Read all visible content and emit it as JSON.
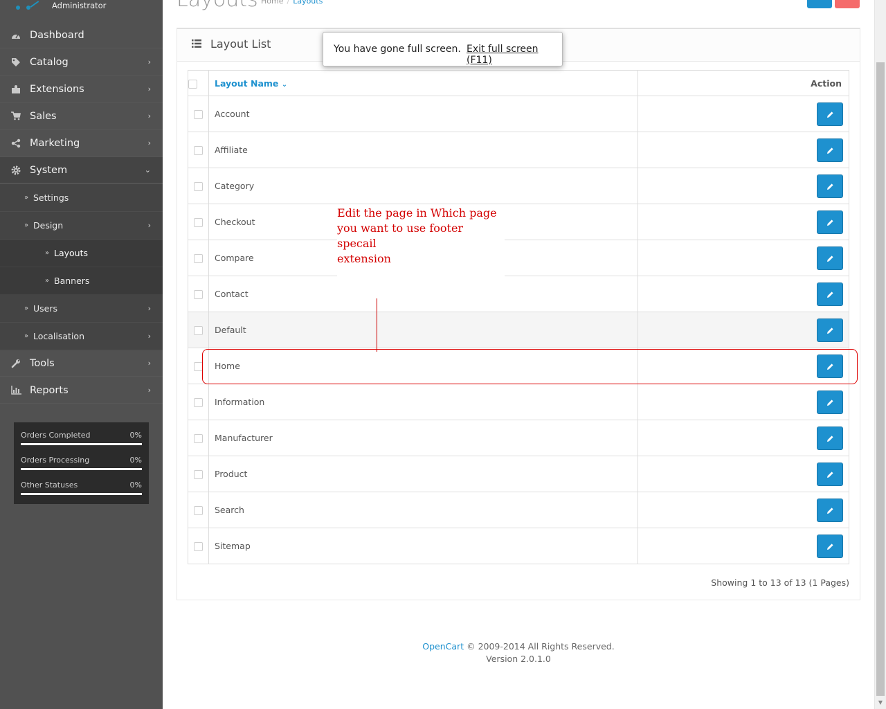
{
  "header": {
    "title": "Layouts",
    "breadcrumb": [
      "Home",
      "Layouts"
    ]
  },
  "profile": {
    "role": "Administrator"
  },
  "sidebar": {
    "items": [
      {
        "label": "Dashboard",
        "icon": "dashboard-icon"
      },
      {
        "label": "Catalog",
        "icon": "tag-icon"
      },
      {
        "label": "Extensions",
        "icon": "puzzle-icon"
      },
      {
        "label": "Sales",
        "icon": "cart-icon"
      },
      {
        "label": "Marketing",
        "icon": "share-icon"
      },
      {
        "label": "System",
        "icon": "gear-icon"
      },
      {
        "label": "Settings"
      },
      {
        "label": "Design"
      },
      {
        "label": "Layouts"
      },
      {
        "label": "Banners"
      },
      {
        "label": "Users"
      },
      {
        "label": "Localisation"
      },
      {
        "label": "Tools",
        "icon": "wrench-icon"
      },
      {
        "label": "Reports",
        "icon": "bar-chart-icon"
      }
    ]
  },
  "stats": [
    {
      "label": "Orders Completed",
      "value": "0%",
      "fraction": 0
    },
    {
      "label": "Orders Processing",
      "value": "0%",
      "fraction": 0
    },
    {
      "label": "Other Statuses",
      "value": "0%",
      "fraction": 0
    }
  ],
  "panel": {
    "title": "Layout List",
    "columns": {
      "name": "Layout Name",
      "action": "Action"
    },
    "rows": [
      "Account",
      "Affiliate",
      "Category",
      "Checkout",
      "Compare",
      "Contact",
      "Default",
      "Home",
      "Information",
      "Manufacturer",
      "Product",
      "Search",
      "Sitemap"
    ],
    "pagination": "Showing 1 to 13 of 13 (1 Pages)"
  },
  "toast": {
    "message": "You have gone full screen.",
    "exit": "Exit full screen (F11)"
  },
  "annotation": {
    "lines": [
      "Edit the page in Which page",
      "you want to use footer specail",
      "extension"
    ]
  },
  "footer": {
    "brand": "OpenCart",
    "copyright": "© 2009-2014 All Rights Reserved.",
    "version": "Version 2.0.1.0"
  },
  "colors": {
    "sidebar_bg": "#515151",
    "accent": "#1e91cf",
    "annotation": "#d30000"
  }
}
